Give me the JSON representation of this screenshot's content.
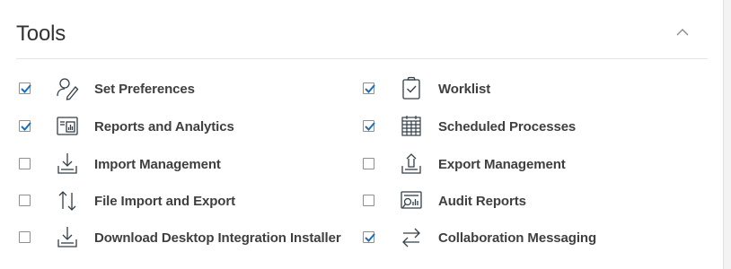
{
  "panel": {
    "title": "Tools",
    "accent_color": "#1a6fb5",
    "icon_color": "#333f48"
  },
  "left_items": [
    {
      "label": "Set Preferences",
      "checked": true,
      "icon": "person-pencil-icon"
    },
    {
      "label": "Reports and Analytics",
      "checked": true,
      "icon": "report-chart-icon"
    },
    {
      "label": "Import Management",
      "checked": false,
      "icon": "download-tray-icon"
    },
    {
      "label": "File Import and Export",
      "checked": false,
      "icon": "up-down-arrows-icon"
    },
    {
      "label": "Download Desktop Integration Installer",
      "checked": false,
      "icon": "download-tray-icon"
    }
  ],
  "right_items": [
    {
      "label": "Worklist",
      "checked": true,
      "icon": "clipboard-check-icon"
    },
    {
      "label": "Scheduled Processes",
      "checked": true,
      "icon": "calendar-grid-icon"
    },
    {
      "label": "Export Management",
      "checked": false,
      "icon": "upload-tray-icon"
    },
    {
      "label": "Audit Reports",
      "checked": false,
      "icon": "audit-report-icon"
    },
    {
      "label": "Collaboration Messaging",
      "checked": true,
      "icon": "exchange-arrows-icon"
    }
  ]
}
